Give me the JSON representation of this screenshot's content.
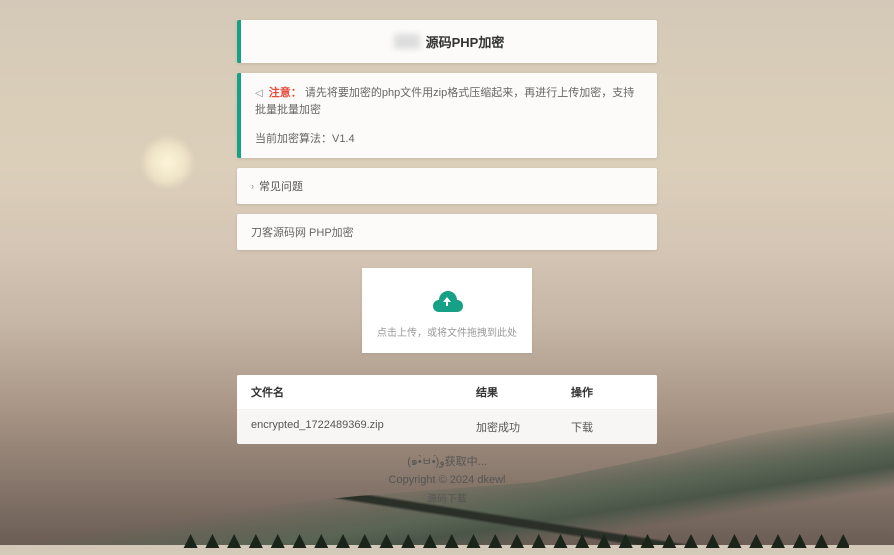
{
  "header": {
    "title_suffix": "源码PHP加密"
  },
  "notice": {
    "label": "注意：",
    "text": "请先将要加密的php文件用zip格式压缩起来，再进行上传加密，支持批量批量加密",
    "version_label": "当前加密算法：",
    "version": "V1.4"
  },
  "faq": {
    "label": "常见问题"
  },
  "breadcrumb": {
    "text": "刀客源码网 PHP加密"
  },
  "upload": {
    "hint": "点击上传，或将文件拖拽到此处"
  },
  "table": {
    "headers": {
      "filename": "文件名",
      "result": "结果",
      "action": "操作"
    },
    "rows": [
      {
        "filename": "encrypted_1722489369.zip",
        "result": "加密成功",
        "action": "下载"
      }
    ]
  },
  "footer": {
    "status": "(๑•̀ㅂ•́)و获取中...",
    "copyright": "Copyright © 2024 dkewl",
    "link": "源码下载"
  }
}
